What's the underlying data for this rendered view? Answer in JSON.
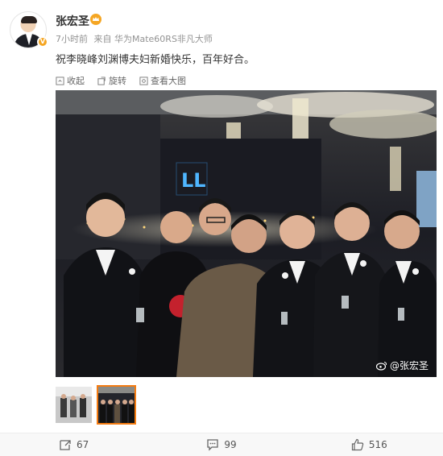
{
  "post": {
    "username": "张宏圣",
    "time": "7小时前",
    "source": "来自 华为Mate60RS非凡大师",
    "content": "祝李晓峰刘渊博夫妇新婚快乐，百年好合。",
    "toolbar": {
      "collapse": "收起",
      "rotate": "旋转",
      "view_large": "查看大图"
    },
    "watermark": "@张宏圣",
    "thumbnails": {
      "count": 2,
      "selected_index": 1
    }
  },
  "actions": {
    "repost": "67",
    "comment": "99",
    "like": "516"
  },
  "colors": {
    "accent": "#f57c12",
    "meta_text": "#939393",
    "vip_gold": "#f5a623"
  }
}
